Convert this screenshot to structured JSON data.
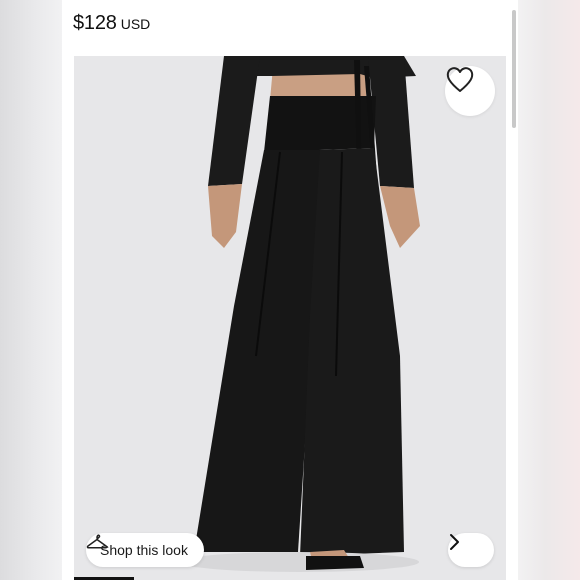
{
  "listing": {
    "price": "$128",
    "currency": "USD"
  },
  "photo": {
    "description_icon": "product-photo",
    "shop_look_label": "Shop this look",
    "slide_progress": 0.14
  },
  "icons": {
    "favorite": "heart-icon",
    "hanger": "hanger-icon",
    "next": "chevron-right-icon"
  },
  "colors": {
    "garment": "#161616",
    "background": "#e7e7e9",
    "skin": "#c99f83"
  }
}
